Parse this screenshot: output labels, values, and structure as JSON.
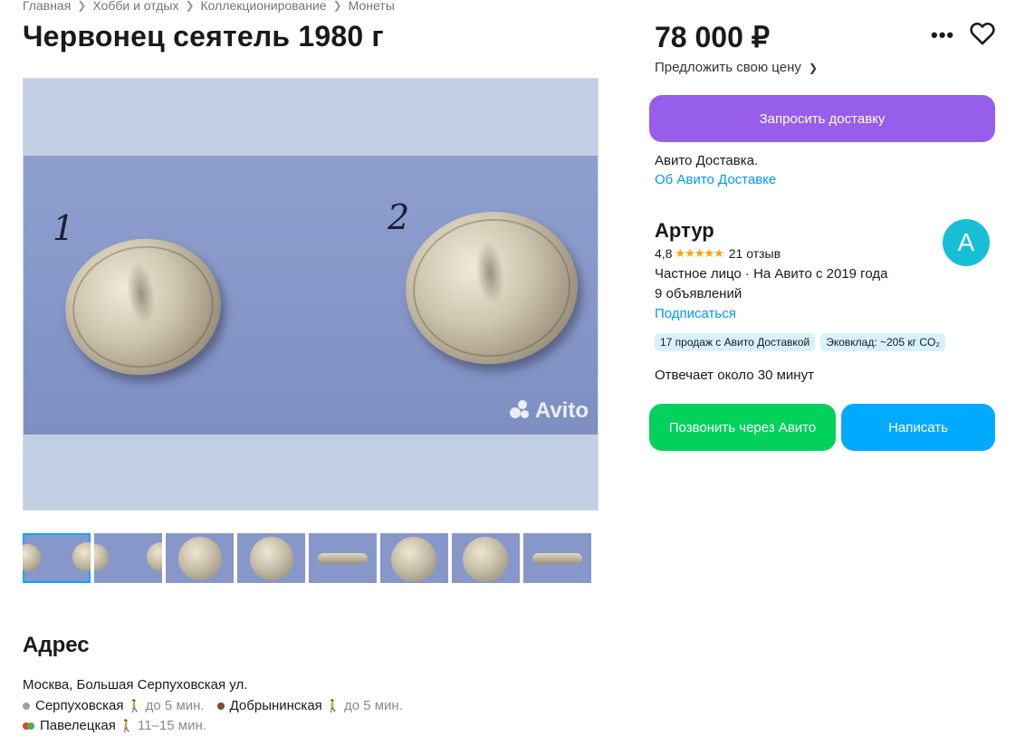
{
  "breadcrumbs": [
    "Главная",
    "Хобби и отдых",
    "Коллекционирование",
    "Монеты"
  ],
  "title": "Червонец сеятель 1980 г",
  "gallery": {
    "watermark": "Avito",
    "coin_labels": [
      "1",
      "2"
    ],
    "thumbnails": [
      {
        "kind": "pair",
        "active": true
      },
      {
        "kind": "pair",
        "active": false
      },
      {
        "kind": "obverse",
        "active": false
      },
      {
        "kind": "reverse",
        "active": false
      },
      {
        "kind": "edge",
        "active": false
      },
      {
        "kind": "obverse",
        "active": false
      },
      {
        "kind": "reverse",
        "active": false
      },
      {
        "kind": "edge",
        "active": false
      }
    ]
  },
  "price": {
    "value": "78 000 ₽",
    "offer_link": "Предложить свою цену"
  },
  "actions": {
    "delivery_button": "Запросить доставку",
    "call_button": "Позвонить через Авито",
    "write_button": "Написать"
  },
  "delivery": {
    "text": "Авито Доставка.",
    "link": "Об Авито Доставке"
  },
  "seller": {
    "name": "Артур",
    "rating": "4,8",
    "stars": "★★★★★",
    "reviews": "21 отзыв",
    "type_line": "Частное лицо · На Авито с 2019 года",
    "ads_count": "9 объявлений",
    "subscribe": "Подписаться",
    "avatar_letter": "А",
    "badges": [
      "17 продаж с Авито Доставкой",
      "Эковклад: ~205 кг CO₂"
    ],
    "reply_time": "Отвечает около 30 минут"
  },
  "address": {
    "section_title": "Адрес",
    "line": "Москва, Большая Серпуховская ул.",
    "metro": [
      {
        "name": "Серпуховская",
        "time": "до 5 мин.",
        "colors": [
          "#a0a0a0"
        ]
      },
      {
        "name": "Добрынинская",
        "time": "до 5 мин.",
        "colors": [
          "#8b4a2b"
        ]
      },
      {
        "name": "Павелецкая",
        "time": "11–15 мин.",
        "colors": [
          "#e0432b",
          "#4caf50"
        ]
      }
    ]
  },
  "colors": {
    "delivery_button": "#965eeb",
    "call_button": "#02d15c",
    "write_button": "#00aaff",
    "link": "#0099f7",
    "avatar": "#16bfd6",
    "stars": "#ffa000"
  }
}
